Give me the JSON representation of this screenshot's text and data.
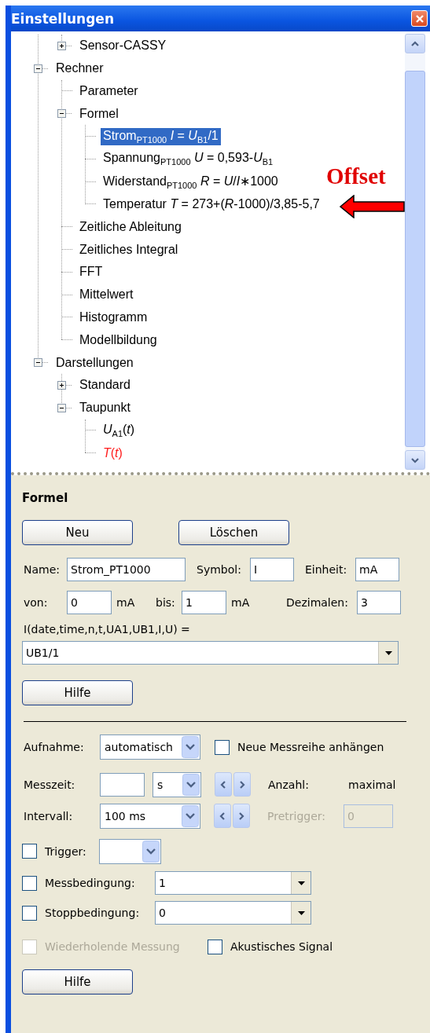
{
  "window": {
    "title": "Einstellungen"
  },
  "tree": {
    "items": [
      {
        "children": [
          {
            "label": "Sensor-CASSY",
            "expanded": false,
            "selected": false
          }
        ]
      },
      {
        "label": "Rechner",
        "expanded": true,
        "selected": false,
        "children": [
          {
            "label": "Parameter",
            "selected": false
          },
          {
            "label": "Formel",
            "expanded": true,
            "selected": false,
            "children": [
              {
                "label": "Strom$_{PT1000}$ *I* = *U*$_{B1}$/1",
                "selected": true
              },
              {
                "label": "Spannung$_{PT1000}$ *U* = 0,593-*U*$_{B1}$",
                "selected": false
              },
              {
                "label": "Widerstand$_{PT1000}$ *R* = *U*/*I*∗1000",
                "selected": false
              },
              {
                "label": "Temperatur *T* = 273+(*R*-1000)/3,85-5,7",
                "selected": false
              }
            ]
          },
          {
            "label": "Zeitliche Ableitung",
            "selected": false
          },
          {
            "label": "Zeitliches Integral",
            "selected": false
          },
          {
            "label": "FFT",
            "selected": false
          },
          {
            "label": "Mittelwert",
            "selected": false
          },
          {
            "label": "Histogramm",
            "selected": false
          },
          {
            "label": "Modellbildung",
            "selected": false
          }
        ]
      },
      {
        "label": "Darstellungen",
        "expanded": true,
        "selected": false,
        "children": [
          {
            "label": "Standard",
            "expanded": false,
            "selected": false
          },
          {
            "label": "Taupunkt",
            "expanded": true,
            "selected": false,
            "children": [
              {
                "label": "*U*$_{A1}$(*t*)",
                "selected": false,
                "color": "#000000"
              },
              {
                "label": "*T*(*t*)",
                "selected": false,
                "color": "#ff2020"
              }
            ]
          }
        ]
      }
    ]
  },
  "annotation": {
    "label": "Offset"
  },
  "formula_panel": {
    "heading": "Formel",
    "buttons": [
      "Neu",
      "Löschen"
    ],
    "name": {
      "label": "Name:",
      "value": "Strom_PT1000"
    },
    "symbol": {
      "label": "Symbol:",
      "value": "I"
    },
    "unit": {
      "label": "Einheit:",
      "value": "mA"
    },
    "from": {
      "label": "von:",
      "value": "0",
      "unit": "mA"
    },
    "to": {
      "label": "bis:",
      "value": "1",
      "unit": "mA"
    },
    "decimals": {
      "label": "Dezimalen:",
      "value": "3"
    },
    "expression_label": "I(date,time,n,t,UA1,UB1,I,U) =",
    "expression": "UB1/1",
    "help": "Hilfe"
  },
  "measurement": {
    "recording": {
      "label": "Aufnahme:",
      "value": "automatisch"
    },
    "append": {
      "label": "Neue Messreihe anhängen",
      "checked": false,
      "disabled": false
    },
    "time": {
      "label": "Messzeit:",
      "unit": "s"
    },
    "count": {
      "label": "Anzahl:",
      "value": "maximal"
    },
    "interval": {
      "label": "Intervall:",
      "value": "100 ms"
    },
    "pretrigger": {
      "label": "Pretrigger:",
      "value": "0",
      "disabled": true
    },
    "trigger": {
      "label": "Trigger:",
      "checked": false,
      "disabled": false
    },
    "condition": {
      "label": "Messbedingung:",
      "checked": false,
      "disabled": false,
      "value": "1"
    },
    "stop": {
      "label": "Stoppbedingung:",
      "checked": false,
      "disabled": false,
      "value": "0"
    },
    "repeat": {
      "label": "Wiederholende Messung",
      "checked": false,
      "disabled": true
    },
    "acoustic": {
      "label": "Akustisches Signal",
      "checked": false,
      "disabled": false
    },
    "help": "Hilfe"
  }
}
